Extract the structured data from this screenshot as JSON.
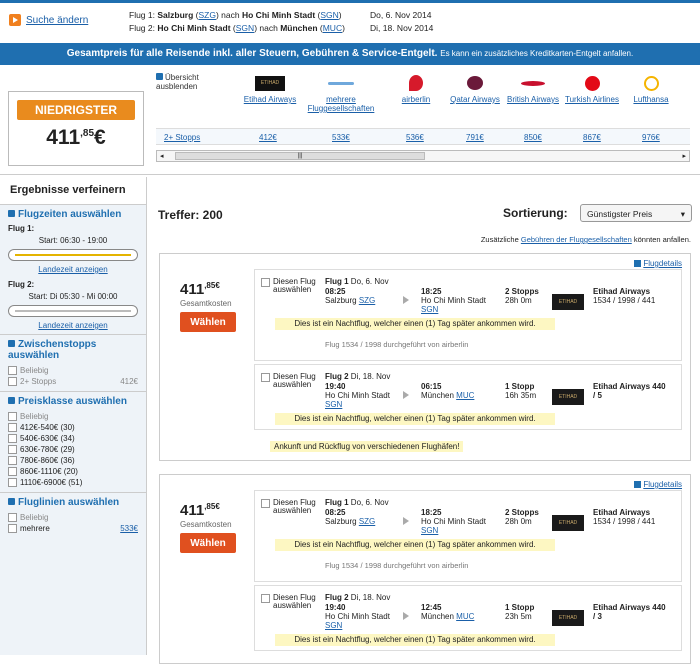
{
  "header": {
    "change_label": "Suche ändern",
    "flight1": {
      "label": "Flug 1:",
      "from": "Salzburg",
      "from_code": "SZG",
      "mid": "nach",
      "to": "Ho Chi Minh Stadt",
      "to_code": "SGN",
      "date": "Do, 6. Nov 2014"
    },
    "flight2": {
      "label": "Flug 2:",
      "from": "Ho Chi Minh Stadt",
      "from_code": "SGN",
      "mid": "nach",
      "to": "München",
      "to_code": "MUC",
      "date": "Di, 18. Nov 2014"
    }
  },
  "banner": {
    "main": "Gesamtpreis für alle Reisende inkl. aller Steuern, Gebühren & Service-Entgelt.",
    "small": "Es kann ein zusätzliches Kreditkarten-Entgelt anfallen."
  },
  "matrix": {
    "lowest_label": "NIEDRIGSTER",
    "lowest_price": "411",
    "lowest_cents": ",85",
    "currency": "€",
    "overview": "Übersicht ausblenden",
    "stops_label": "2+ Stopps",
    "airlines": [
      {
        "name": "Etihad Airways",
        "price": "412€"
      },
      {
        "name": "mehrere Fluggesellschaften",
        "price": "533€"
      },
      {
        "name": "airberlin",
        "price": "536€"
      },
      {
        "name": "Qatar Airways",
        "price": "791€"
      },
      {
        "name": "British Airways",
        "price": "850€"
      },
      {
        "name": "Turkish Airlines",
        "price": "867€"
      },
      {
        "name": "Lufthansa",
        "price": "976€"
      }
    ],
    "logo_text": "ETIHAD"
  },
  "sidebar": {
    "title": "Ergebnisse verfeinern",
    "times": {
      "title": "Flugzeiten auswählen",
      "f1": "Flug 1:",
      "f1_start": "Start: 06:30 - 19:00",
      "f2": "Flug 2:",
      "f2_start": "Start: Di 05:30 - Mi 00:00",
      "land_link": "Landezeit anzeigen"
    },
    "stops": {
      "title": "Zwischenstopps auswählen",
      "any": "Beliebig",
      "opt": "2+ Stopps",
      "opt_price": "412€"
    },
    "price": {
      "title": "Preisklasse auswählen",
      "any": "Beliebig",
      "ranges": [
        "412€-540€ (30)",
        "540€-630€ (34)",
        "630€-780€ (29)",
        "780€-860€ (36)",
        "860€-1110€ (20)",
        "1110€-6900€ (51)"
      ]
    },
    "airlines": {
      "title": "Fluglinien auswählen",
      "any": "Beliebig",
      "first": "mehrere",
      "first_price": "533€"
    }
  },
  "main": {
    "hits": "Treffer: 200",
    "sort_label": "Sortierung:",
    "sort_value": "Günstigster Preis",
    "note_prefix": "Zusätzliche",
    "note_link": "Gebühren der Fluggesellschaften",
    "note_suffix": "könnten anfallen.",
    "results": [
      {
        "price": "411",
        "cents": ",85€",
        "total": "Gesamtkosten",
        "btn": "Wählen",
        "details": "Flugdetails",
        "leg1": {
          "cb": "Diesen Flug auswählen",
          "title": "Flug 1",
          "date": "Do, 6. Nov",
          "dep": "08:25",
          "from": "Salzburg",
          "from_code": "SZG",
          "arr": "18:25",
          "to": "Ho Chi Minh Stadt",
          "to_code": "SGN",
          "stops": "2 Stopps",
          "dur": "28h 0m",
          "airline": "Etihad Airways",
          "nums": "1534 / 1998 / 441",
          "night": "Dies ist ein Nachtflug, welcher einen (1) Tag später ankommen wird.",
          "op": "Flug 1534 / 1998 durchgeführt von airberlin"
        },
        "leg2": {
          "cb": "Diesen Flug auswählen",
          "title": "Flug 2",
          "date": "Di, 18. Nov",
          "dep": "19:40",
          "from": "Ho Chi Minh Stadt",
          "from_code": "SGN",
          "arr": "06:15",
          "to": "München",
          "to_code": "MUC",
          "stops": "1 Stopp",
          "dur": "16h 35m",
          "airline": "Etihad Airways 440",
          "nums": "/ 5",
          "night": "Dies ist ein Nachtflug, welcher einen (1) Tag später ankommen wird."
        },
        "diff": "Ankunft und Rückflug von verschiedenen Flughäfen!"
      },
      {
        "price": "411",
        "cents": ",85€",
        "total": "Gesamtkosten",
        "btn": "Wählen",
        "details": "Flugdetails",
        "leg1": {
          "cb": "Diesen Flug auswählen",
          "title": "Flug 1",
          "date": "Do, 6. Nov",
          "dep": "08:25",
          "from": "Salzburg",
          "from_code": "SZG",
          "arr": "18:25",
          "to": "Ho Chi Minh Stadt",
          "to_code": "SGN",
          "stops": "2 Stopps",
          "dur": "28h 0m",
          "airline": "Etihad Airways",
          "nums": "1534 / 1998 / 441",
          "night": "Dies ist ein Nachtflug, welcher einen (1) Tag später ankommen wird.",
          "op": "Flug 1534 / 1998 durchgeführt von airberlin"
        },
        "leg2": {
          "cb": "Diesen Flug auswählen",
          "title": "Flug 2",
          "date": "Di, 18. Nov",
          "dep": "19:40",
          "from": "Ho Chi Minh Stadt",
          "from_code": "SGN",
          "arr": "12:45",
          "to": "München",
          "to_code": "MUC",
          "stops": "1 Stopp",
          "dur": "23h 5m",
          "airline": "Etihad Airways 440",
          "nums": "/ 3",
          "night": "Dies ist ein Nachtflug, welcher einen (1) Tag später ankommen wird."
        }
      }
    ]
  }
}
